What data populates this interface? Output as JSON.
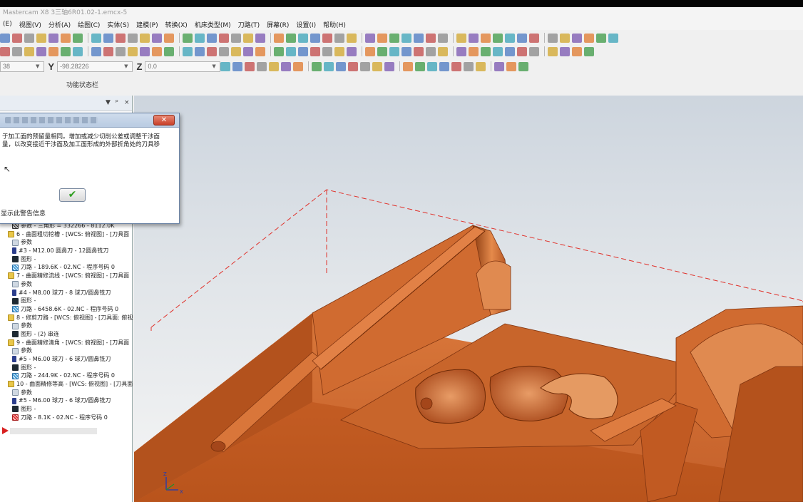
{
  "window": {
    "title": "Mastercam X8  3三轴6R01.02-1.emcx-5"
  },
  "menu": [
    {
      "label": "(E)"
    },
    {
      "label": "视图(V)"
    },
    {
      "label": "分析(A)"
    },
    {
      "label": "绘图(C)"
    },
    {
      "label": "实体(S)"
    },
    {
      "label": "建模(P)"
    },
    {
      "label": "转换(X)"
    },
    {
      "label": "机床类型(M)"
    },
    {
      "label": "刀路(T)"
    },
    {
      "label": "屏幕(R)"
    },
    {
      "label": "设置(I)"
    },
    {
      "label": "帮助(H)"
    }
  ],
  "coords": {
    "x_value": "38",
    "y_label": "Y",
    "y_value": "-98.28226",
    "z_label": "Z",
    "z_value": "0.0"
  },
  "function_label": "功能状态栏",
  "dialog": {
    "message_line1": "于加工面的预留量相同。增加或减少切削公差或调整干涉面",
    "message_line2": "量，以改变接近干涉面及加工面形成的外部折角处的刀具移",
    "ok_glyph": "✔",
    "close_glyph": "✕",
    "checkbox_label": "显示此警告信息"
  },
  "tree": [
    {
      "indent": 1,
      "icon": "hatch",
      "label": "参数 - 三角形 = 332266 - 8112.0K"
    },
    {
      "indent": 0,
      "icon": "folder",
      "label": "6 - 曲面粗切挖槽 - [WCS: 俯视图] - [刀具面"
    },
    {
      "indent": 1,
      "icon": "params",
      "label": "参数"
    },
    {
      "indent": 1,
      "icon": "tool",
      "label": "#3 - M12.00 圆鼻刀 - 12圆鼻铣刀"
    },
    {
      "indent": 1,
      "icon": "geom",
      "label": "图形 -"
    },
    {
      "indent": 1,
      "icon": "path",
      "label": "刀路 - 189.6K - 02.NC - 程序号码 0"
    },
    {
      "indent": 0,
      "icon": "folder",
      "label": "7 - 曲面精修流线 - [WCS: 俯视图] - [刀具面"
    },
    {
      "indent": 1,
      "icon": "params",
      "label": "参数"
    },
    {
      "indent": 1,
      "icon": "tool",
      "label": "#4 - M8.00 球刀 - 8 球刀/圆鼻铣刀"
    },
    {
      "indent": 1,
      "icon": "geom",
      "label": "图形 -"
    },
    {
      "indent": 1,
      "icon": "path",
      "label": "刀路 - 6458.6K - 02.NC - 程序号码 0"
    },
    {
      "indent": 0,
      "icon": "folder",
      "label": "8 - 修剪刀路 - [WCS: 俯视图] - [刀具面: 俯视"
    },
    {
      "indent": 1,
      "icon": "params",
      "label": "参数"
    },
    {
      "indent": 1,
      "icon": "geom",
      "label": "图形 - (2) 串连"
    },
    {
      "indent": 0,
      "icon": "folder",
      "label": "9 - 曲面精修清角 - [WCS: 俯视图] - [刀具面"
    },
    {
      "indent": 1,
      "icon": "params",
      "label": "参数"
    },
    {
      "indent": 1,
      "icon": "tool",
      "label": "#5 - M6.00 球刀 - 6 球刀/圆鼻铣刀"
    },
    {
      "indent": 1,
      "icon": "geom",
      "label": "图形 -"
    },
    {
      "indent": 1,
      "icon": "path",
      "label": "刀路 - 244.9K - 02.NC - 程序号码 0"
    },
    {
      "indent": 0,
      "icon": "folder",
      "label": "10 - 曲面精修等高 - [WCS: 俯视图] - [刀具面"
    },
    {
      "indent": 1,
      "icon": "params",
      "label": "参数"
    },
    {
      "indent": 1,
      "icon": "tool",
      "label": "#5 - M6.00 球刀 - 6 球刀/圆鼻铣刀"
    },
    {
      "indent": 1,
      "icon": "geom",
      "label": "图形 -"
    },
    {
      "indent": 1,
      "icon": "pathred",
      "label": "刀路 - 8.1K - 02.NC - 程序号码 0"
    }
  ],
  "axis": {
    "z": "Z",
    "x": "X",
    "y": "Y"
  },
  "colors": {
    "part": "#c8642a",
    "part_dark": "#8f3f12",
    "stock_box": "#e0312a"
  }
}
